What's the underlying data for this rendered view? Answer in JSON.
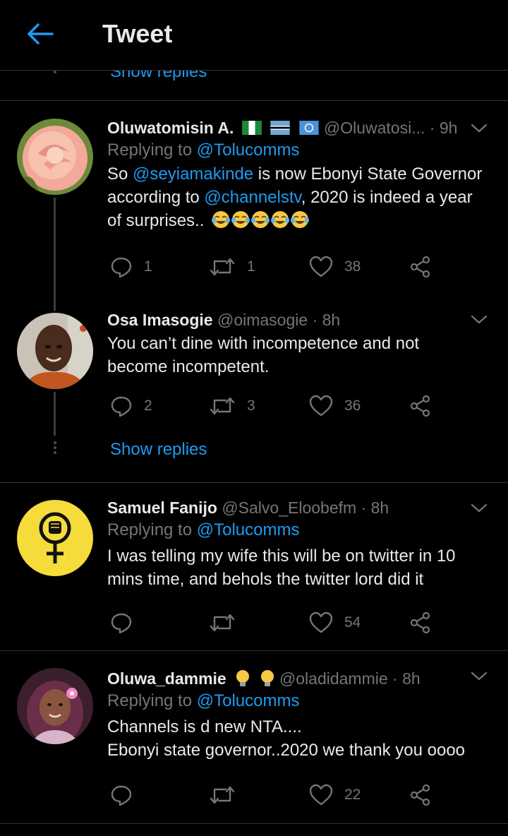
{
  "header": {
    "title": "Tweet"
  },
  "partial_link": "Show replies",
  "tweets": [
    {
      "name": "Oluwatomisin A.",
      "handle": "@Oluwatosi...",
      "dot": "·",
      "time": "9h",
      "replying_prefix": "Replying to",
      "replying_to": "@Tolucomms",
      "text": {
        "part1": "So ",
        "mention1": "@seyiamakinde",
        "part2": " is now Ebonyi State Governor",
        "part3": "according to ",
        "mention2": "@channelstv",
        "part4": ", 2020 is indeed a year",
        "part5": "of surprises.."
      },
      "replies": "1",
      "retweets": "1",
      "likes": "38"
    },
    {
      "name": "Osa Imasogie",
      "handle": "@oimasogie",
      "dot": "·",
      "time": "8h",
      "line1": "You can’t dine with incompetence and not",
      "line2": "become  incompetent.",
      "replies": "2",
      "retweets": "3",
      "likes": "36",
      "show_replies": "Show replies"
    },
    {
      "name": "Samuel Fanijo",
      "handle": "@Salvo_Eloobefm",
      "dot": "·",
      "time": "8h",
      "replying_prefix": "Replying to",
      "replying_to": "@Tolucomms",
      "line1": "I was telling my wife this will be on twitter in 10",
      "line2": "mins time, and behols the twitter lord did it",
      "likes": "54"
    },
    {
      "name": "Oluwa_dammie",
      "handle": "@oladidammie",
      "dot": "·",
      "time": "8h",
      "replying_prefix": "Replying to",
      "replying_to": "@Tolucomms",
      "line1": "Channels is d new NTA....",
      "line2": "Ebonyi state governor..2020 we thank you oooo",
      "likes": "22"
    }
  ],
  "icons": {
    "back": "arrow-left-icon",
    "reply": "reply-icon",
    "retweet": "retweet-icon",
    "like": "heart-icon",
    "share": "share-icon",
    "caret": "chevron-down-icon"
  },
  "colors": {
    "accent": "#1d9bf0",
    "muted": "#71767b",
    "background": "#000000"
  }
}
